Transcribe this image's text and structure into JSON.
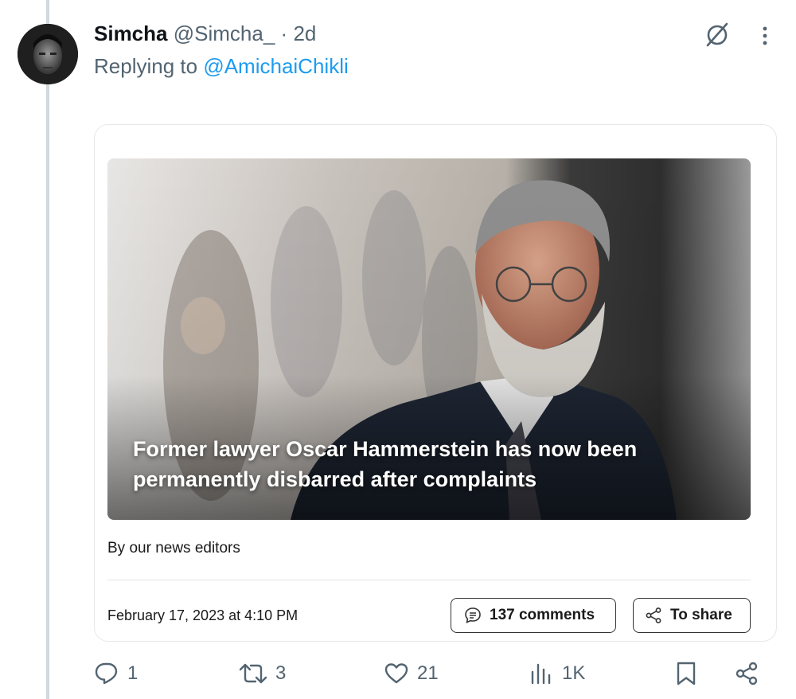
{
  "tweet": {
    "name": "Simcha",
    "handle": "@Simcha_",
    "dot": "·",
    "time": "2d",
    "replying_prefix": "Replying to ",
    "replying_to": "@AmichaiChikli"
  },
  "card": {
    "headline": "Former lawyer Oscar Hammerstein has now been permanently disbarred after complaints",
    "byline": "By our news editors",
    "date": "February 17, 2023 at 4:10 PM",
    "comments_label": "137 comments",
    "share_label": "To share"
  },
  "actions": {
    "replies": "1",
    "retweets": "3",
    "likes": "21",
    "views": "1K"
  },
  "icons": {
    "grok": "grok-icon",
    "more": "more-icon",
    "reply": "reply-icon",
    "retweet": "retweet-icon",
    "like": "heart-icon",
    "views": "views-icon",
    "bookmark": "bookmark-icon",
    "share": "share-icon"
  },
  "colors": {
    "link": "#1d9bf0",
    "muted": "#536471",
    "text": "#0f1419",
    "thread_line": "#cfd9de"
  }
}
